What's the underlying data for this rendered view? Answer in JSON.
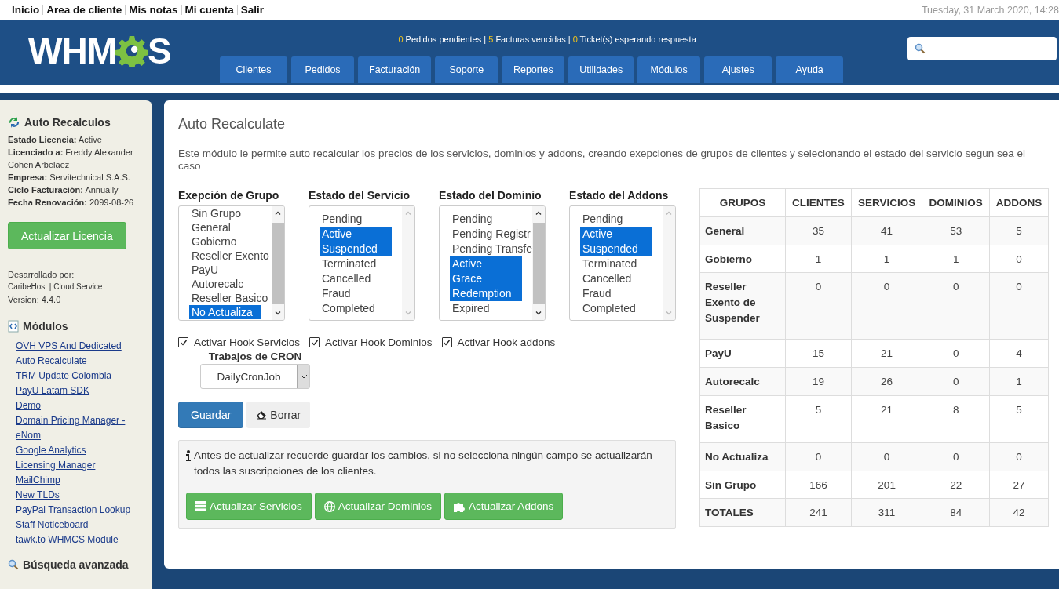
{
  "top_links": [
    "Inicio",
    "Area de cliente",
    "Mis notas",
    "Mi cuenta",
    "Salir"
  ],
  "date": "Tuesday, 31 March 2020, 14:28",
  "logo": {
    "before": "WHM",
    "after": "S"
  },
  "alert_separator": "|",
  "alerts": [
    {
      "count": "0",
      "label": "Pedidos pendientes"
    },
    {
      "count": "5",
      "label": "Facturas vencidas"
    },
    {
      "count": "0",
      "label": "Ticket(s) esperando respuesta"
    }
  ],
  "nav_tabs": [
    "Clientes",
    "Pedidos",
    "Facturación",
    "Soporte",
    "Reportes",
    "Utilidades",
    "Módulos",
    "Ajustes",
    "Ayuda"
  ],
  "sidebar": {
    "title": "Auto Recalculos",
    "license": [
      {
        "label": "Estado Licencia:",
        "value": "Active"
      },
      {
        "label": "Licenciado a:",
        "value": "Freddy Alexander Cohen Arbelaez"
      },
      {
        "label": "Empresa:",
        "value": "Servitechnical S.A.S."
      },
      {
        "label": "Ciclo Facturación:",
        "value": "Annually"
      },
      {
        "label": "Fecha Renovación:",
        "value": "2099-08-26"
      }
    ],
    "license_button": "Actualizar Licencia",
    "developed_by": "Desarrollado por:",
    "developer": "CaribeHost | Cloud Service",
    "version": "Version: 4.4.0",
    "modules_title": "Módulos",
    "modules": [
      "OVH VPS And Dedicated",
      "Auto Recalculate",
      "TRM Update Colombia",
      "PayU Latam SDK",
      "Demo",
      "Domain Pricing Manager - eNom",
      "Google Analytics",
      "Licensing Manager",
      "MailChimp",
      "New TLDs",
      "PayPal Transaction Lookup",
      "Staff Noticeboard",
      "tawk.to WHMCS Module"
    ],
    "search_title": "Búsqueda avanzada"
  },
  "page": {
    "title": "Auto Recalculate",
    "description": "Este módulo le permite auto recalcular los precios de los servicios, dominios y addons, creando exepciones de grupos de clientes y selecionando el estado del servicio segun sea el caso",
    "lists": [
      {
        "label": "Exepción de Grupo",
        "scroll": true,
        "items": [
          {
            "text": "Sin Grupo",
            "selected": false
          },
          {
            "text": "General",
            "selected": false
          },
          {
            "text": "Gobierno",
            "selected": false
          },
          {
            "text": "Reseller Exento",
            "selected": false
          },
          {
            "text": "PayU",
            "selected": false
          },
          {
            "text": "Autorecalc",
            "selected": false
          },
          {
            "text": "Reseller Basico",
            "selected": false
          },
          {
            "text": "No Actualiza",
            "selected": true
          }
        ]
      },
      {
        "label": "Estado del Servicio",
        "scroll": false,
        "items": [
          {
            "text": "Pending",
            "selected": false
          },
          {
            "text": "Active",
            "selected": true
          },
          {
            "text": "Suspended",
            "selected": true
          },
          {
            "text": "Terminated",
            "selected": false
          },
          {
            "text": "Cancelled",
            "selected": false
          },
          {
            "text": "Fraud",
            "selected": false
          },
          {
            "text": "Completed",
            "selected": false
          }
        ]
      },
      {
        "label": "Estado del Dominio",
        "scroll": true,
        "items": [
          {
            "text": "Pending",
            "selected": false
          },
          {
            "text": "Pending Registr",
            "selected": false
          },
          {
            "text": "Pending Transfe",
            "selected": false
          },
          {
            "text": "Active",
            "selected": true
          },
          {
            "text": "Grace",
            "selected": true
          },
          {
            "text": "Redemption",
            "selected": true
          },
          {
            "text": "Expired",
            "selected": false
          }
        ]
      },
      {
        "label": "Estado del Addons",
        "scroll": false,
        "items": [
          {
            "text": "Pending",
            "selected": false
          },
          {
            "text": "Active",
            "selected": true
          },
          {
            "text": "Suspended",
            "selected": true
          },
          {
            "text": "Terminated",
            "selected": false
          },
          {
            "text": "Cancelled",
            "selected": false
          },
          {
            "text": "Fraud",
            "selected": false
          },
          {
            "text": "Completed",
            "selected": false
          }
        ]
      }
    ],
    "hooks": [
      {
        "label": "Activar Hook Servicios",
        "checked": true
      },
      {
        "label": "Activar Hook Dominios",
        "checked": true
      },
      {
        "label": "Activar Hook addons",
        "checked": true
      }
    ],
    "cron_label": "Trabajos de CRON",
    "cron_value": "DailyCronJob",
    "save": "Guardar",
    "clear": "Borrar",
    "notice": "Antes de actualizar recuerde guardar los cambios, si no selecciona ningún campo se actualizarán todos las suscripciones de los clientes.",
    "update_buttons": [
      {
        "kind": "services",
        "label": "Actualizar Servicios"
      },
      {
        "kind": "domains",
        "label": "Actualizar Dominios"
      },
      {
        "kind": "addons",
        "label": "Actualizar Addons"
      }
    ]
  },
  "table": {
    "columns": [
      "GRUPOS",
      "CLIENTES",
      "SERVICIOS",
      "DOMINIOS",
      "ADDONS"
    ],
    "rows": [
      [
        "General",
        "35",
        "41",
        "53",
        "5"
      ],
      [
        "Gobierno",
        "1",
        "1",
        "1",
        "0"
      ],
      [
        "Reseller Exento de Suspender",
        "0",
        "0",
        "0",
        "0"
      ],
      [
        "PayU",
        "15",
        "21",
        "0",
        "4"
      ],
      [
        "Autorecalc",
        "19",
        "26",
        "0",
        "1"
      ],
      [
        "Reseller Basico",
        "5",
        "21",
        "8",
        "5"
      ],
      [
        "No Actualiza",
        "0",
        "0",
        "0",
        "0"
      ],
      [
        "Sin Grupo",
        "166",
        "201",
        "22",
        "27"
      ],
      [
        "TOTALES",
        "241",
        "311",
        "84",
        "42"
      ]
    ]
  }
}
